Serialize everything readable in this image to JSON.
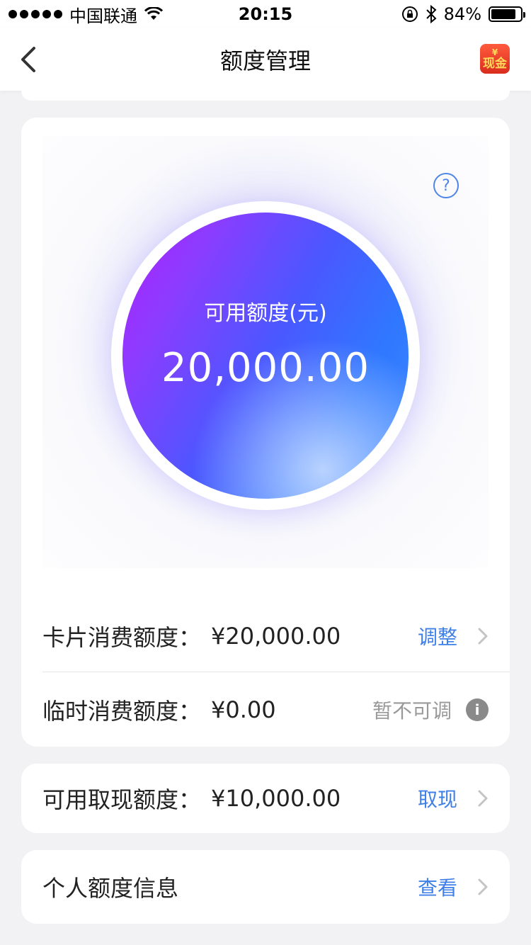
{
  "status_bar": {
    "carrier": "中国联通",
    "time": "20:15",
    "battery_percent": "84%",
    "battery_level": 0.84
  },
  "nav": {
    "title": "额度管理",
    "cash_badge_label": "现金",
    "cash_badge_symbol": "¥"
  },
  "credit": {
    "available_label": "可用额度(元)",
    "available_amount": "20,000.00",
    "help_symbol": "?"
  },
  "rows": [
    {
      "label": "卡片消费额度：",
      "value": "¥20,000.00",
      "action": "调整"
    },
    {
      "label": "临时消费额度：",
      "value": "¥0.00",
      "action": "暂不可调",
      "info_symbol": "i"
    },
    {
      "label": "可用取现额度：",
      "value": "¥10,000.00",
      "action": "取现"
    },
    {
      "label": "个人额度信息",
      "value": "",
      "action": "查看"
    }
  ],
  "colors": {
    "accent": "#3f7fe8",
    "orb_start": "#b120ff",
    "orb_end": "#2f78ff",
    "background": "#f2f2f4"
  },
  "icons": [
    "wifi-icon",
    "orientation-lock-icon",
    "bluetooth-icon",
    "battery-icon",
    "back-chevron-icon",
    "cash-badge-icon",
    "help-icon",
    "chevron-right-icon",
    "info-icon"
  ]
}
